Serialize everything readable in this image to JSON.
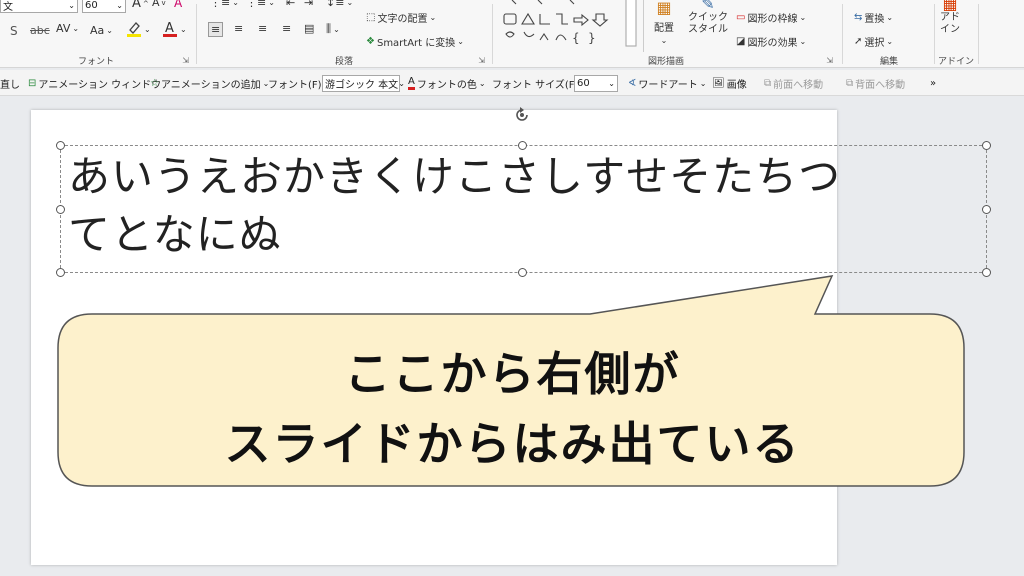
{
  "ribbon": {
    "font_group": {
      "label": "フォント",
      "font_name_partial": "文",
      "font_size": "60",
      "strike_label": "S",
      "spacing_label": "AV",
      "case_label": "Aa",
      "grow_label": "A",
      "shrink_label": "A",
      "clear_label": "A"
    },
    "paragraph_group": {
      "label": "段落",
      "text_align_label": "文字の配置",
      "smartart_label": "SmartArt に変換"
    },
    "drawing_group": {
      "label": "図形描画",
      "arrange_label": "配置",
      "quick_style_label": "クイック\nスタイル",
      "outline_label": "図形の枠線",
      "effect_label": "図形の効果"
    },
    "editing_group": {
      "label": "編集",
      "replace_label": "置換",
      "select_label": "選択"
    },
    "addin_group": {
      "label": "アドイン",
      "addin_label": "アド\nイン"
    }
  },
  "quickbar": {
    "left_partial": "直し",
    "animation_window": "アニメーション ウィンドウ",
    "add_animation": "アニメーションの追加",
    "font_label": "フォント(F):",
    "font_value": "游ゴシック 本文",
    "font_color": "フォントの色",
    "font_size_label": "フォント サイズ(F):",
    "font_size_value": "60",
    "wordart": "ワードアート",
    "image": "画像",
    "bring_forward": "前面へ移動",
    "send_backward": "背面へ移動",
    "more": "»"
  },
  "slide": {
    "textbox_line1": "あいうえおかきくけこさしすせそたちつ",
    "textbox_line2": "てとなにぬ",
    "callout_line1": "ここから右側が",
    "callout_line2": "スライドからはみ出ている"
  },
  "colors": {
    "callout_fill": "#fdf1cc",
    "callout_border": "#555555",
    "highlight_yellow": "#f5e400",
    "font_red": "#d62020"
  }
}
